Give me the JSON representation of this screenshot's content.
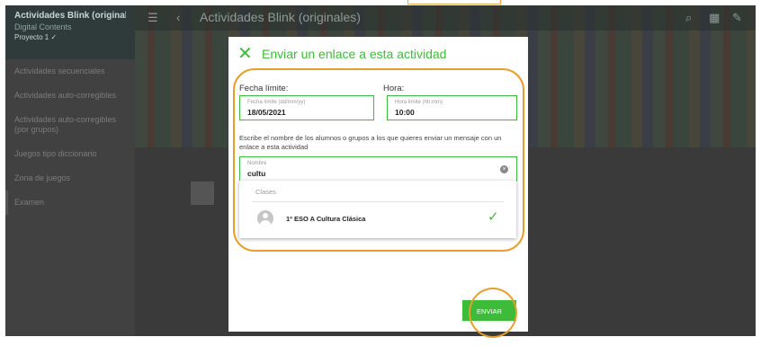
{
  "background": {
    "course_title": "Actividades Blink (originales)",
    "course_subtitle": "Digital Contents",
    "course_meta": "Proyecto 1 ✓",
    "page_title": "Actividades Blink (originales)",
    "sidebar_items": [
      "Actividades secuenciales",
      "Actividades auto-corregibles",
      "Actividades auto-corregibles (por grupos)",
      "Juegos tipo diccionario",
      "Zona de juegos",
      "Examen"
    ]
  },
  "modal": {
    "close_icon": "close-x-icon",
    "title": "Enviar un enlace a esta actividad",
    "date_label": "Fecha límite:",
    "date_placeholder": "Fecha límite (dd/mm/yy)",
    "date_value": "18/05/2021",
    "time_label": "Hora:",
    "time_placeholder": "Hora límite (hh:mm)",
    "time_value": "10:00",
    "help_text": "Escribe el nombre de los alumnos o grupos a los que quieres enviar un mensaje con un enlace a esta actividad",
    "name_placeholder": "Nombre",
    "name_value": "cultu",
    "dropdown": {
      "header": "Clases",
      "items": [
        {
          "label": "1º ESO A Cultura Clásica",
          "selected": true
        }
      ]
    },
    "send_label": "ENVIAR"
  },
  "colors": {
    "accent": "#3dbb3a",
    "highlight": "#e89e2c"
  }
}
